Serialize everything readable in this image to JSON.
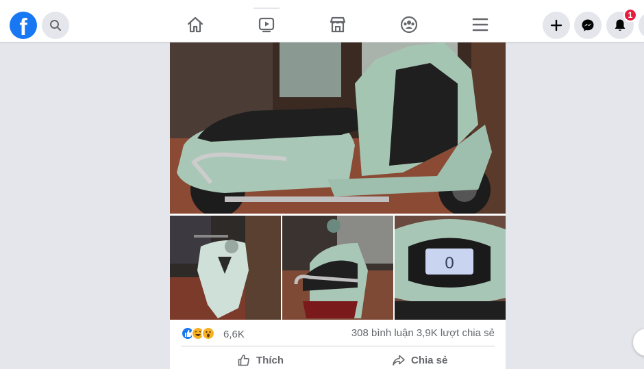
{
  "header": {
    "logo_letter": "f",
    "notification_badge": "1",
    "nav": [
      "home",
      "watch",
      "marketplace",
      "groups",
      "menu"
    ]
  },
  "post": {
    "photos": [
      {
        "label": "scooter-main"
      },
      {
        "label": "scooter-front"
      },
      {
        "label": "scooter-rear"
      },
      {
        "label": "scooter-dashboard"
      }
    ],
    "reactions": [
      "like",
      "haha",
      "wow"
    ],
    "reaction_count": "6,6K",
    "comments_shares": "308 bình luận  3,9K lượt chia sẻ",
    "actions": {
      "like_label": "Thích",
      "share_label": "Chia sẻ"
    }
  },
  "colors": {
    "brand": "#1877f2",
    "badge": "#e41e3f",
    "background": "#e4e6eb",
    "secondary_text": "#65676b"
  }
}
